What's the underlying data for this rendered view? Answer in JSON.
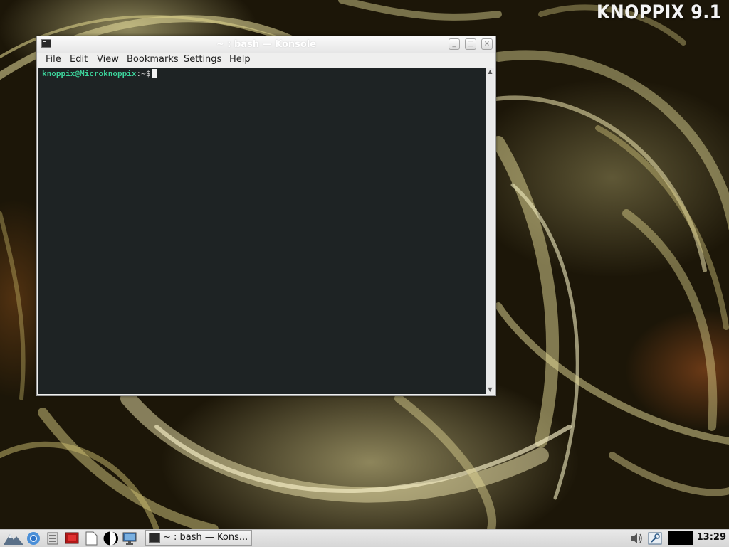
{
  "desktop": {
    "brand_text": "KNOPPIX 9.1"
  },
  "window": {
    "title": "~ : bash — Konsole",
    "buttons": [
      "minimize",
      "maximize",
      "close"
    ],
    "menu": [
      "File",
      "Edit",
      "View",
      "Bookmarks",
      "Settings",
      "Help"
    ]
  },
  "terminal": {
    "prompt_user_host": "knoppix@Microknoppix",
    "prompt_path": ":~$",
    "background_color": "#1e2324",
    "prompt_color": "#3cd29a"
  },
  "taskbar": {
    "launchers": [
      "start-menu-icon",
      "chromium-icon",
      "file-manager-icon",
      "terminal-launcher-icon",
      "text-editor-icon",
      "contrast-icon",
      "monitor-icon"
    ],
    "task_label": "~ : bash — Kons...",
    "tray": [
      "volume-icon",
      "network-icon"
    ],
    "clock": "13:29"
  }
}
